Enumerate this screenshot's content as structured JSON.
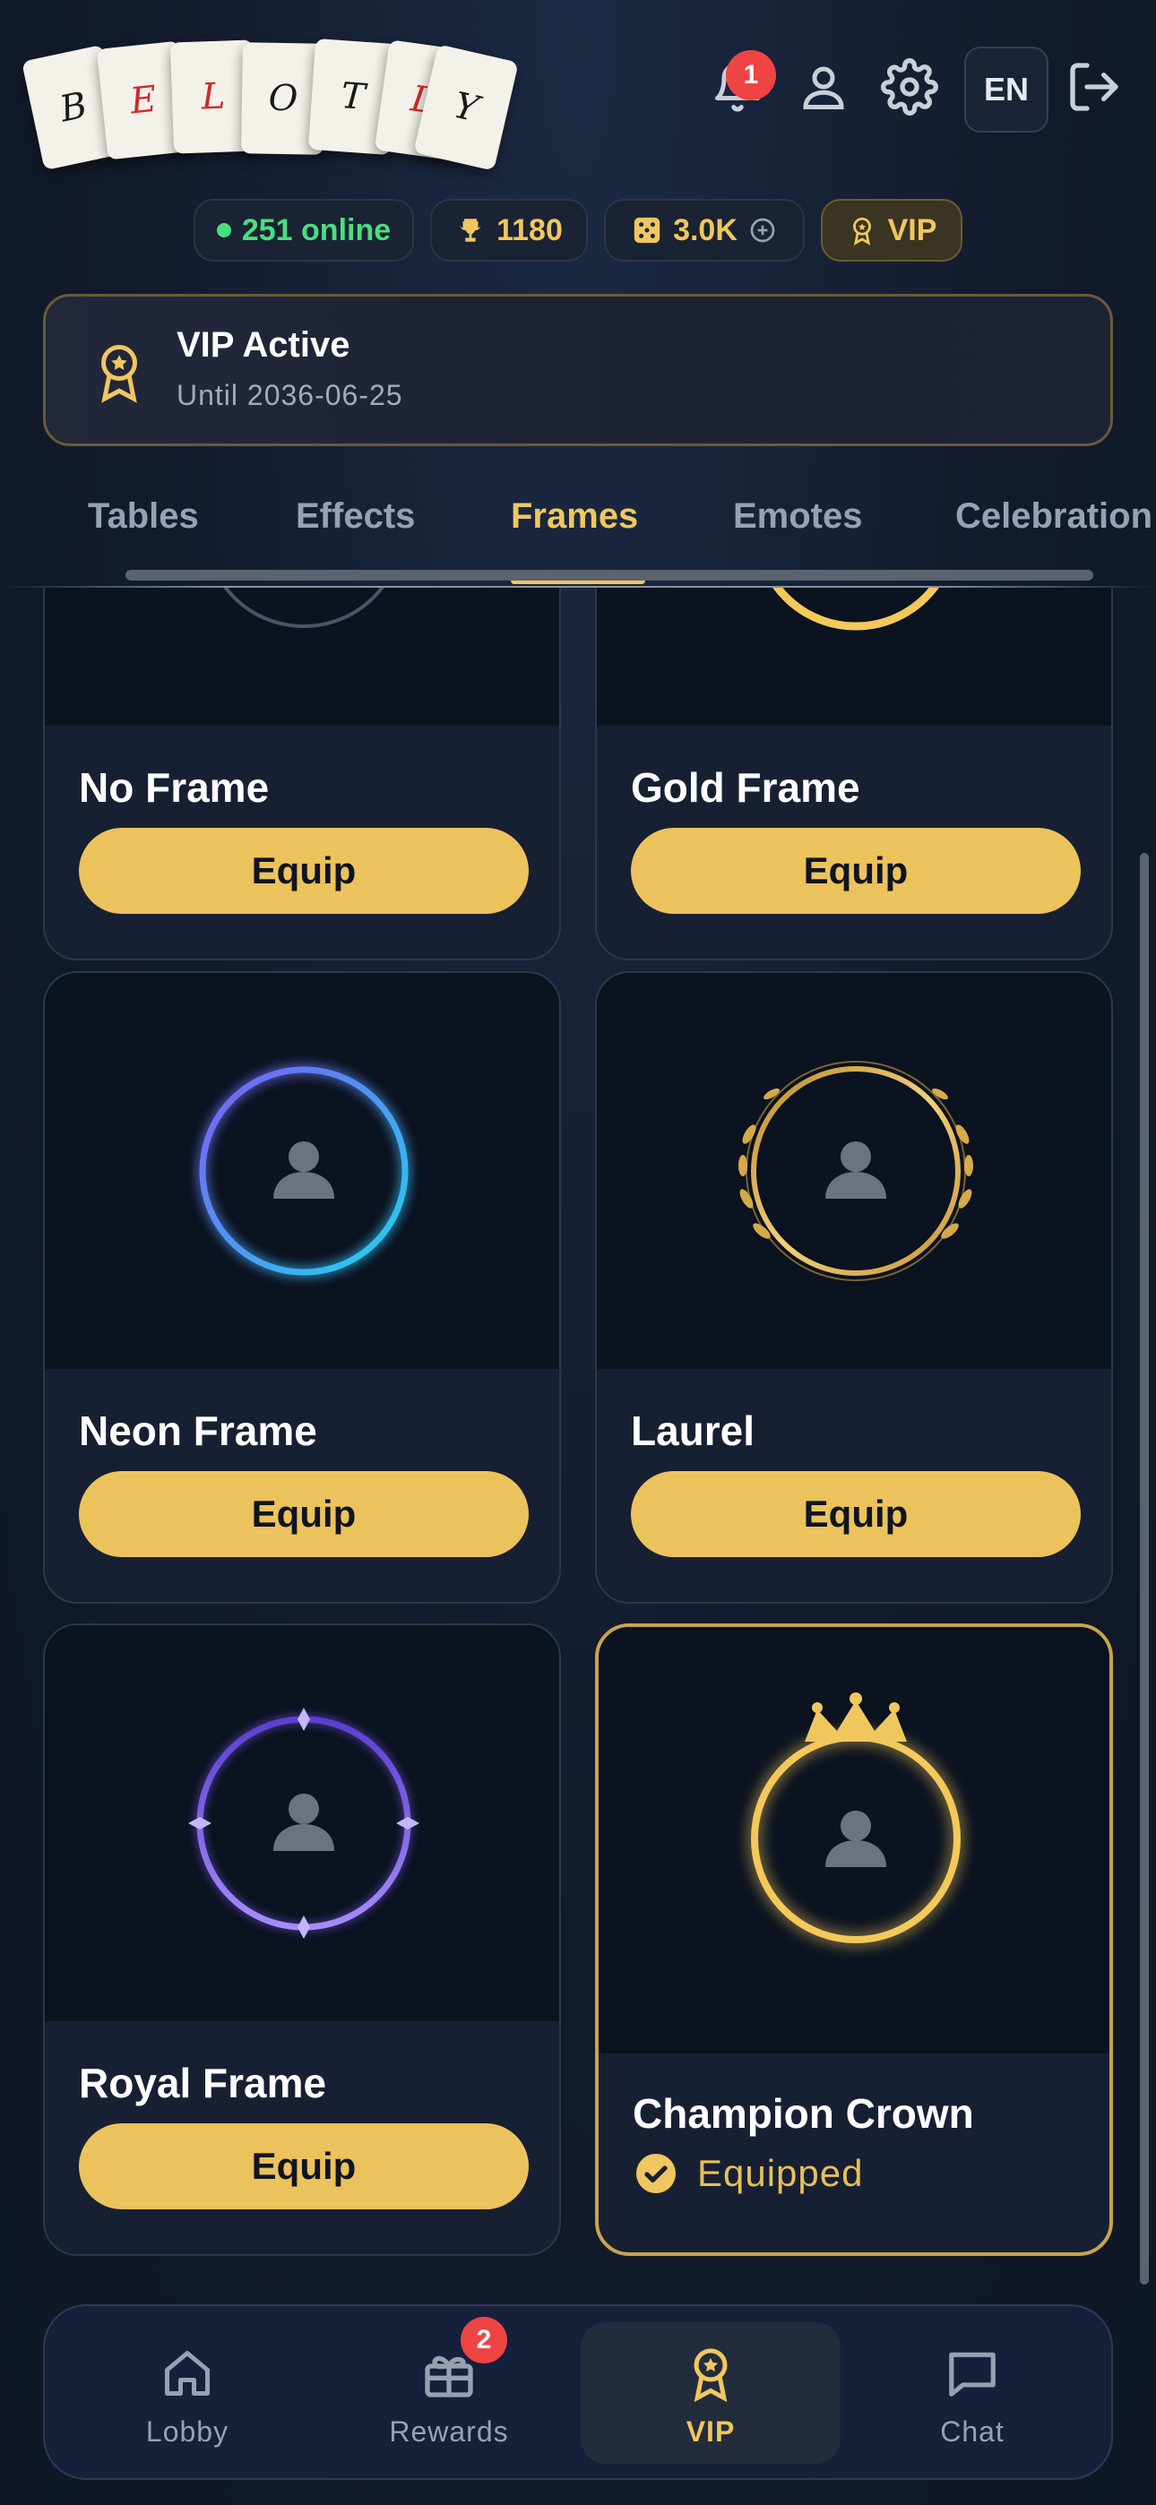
{
  "app": {
    "logo_letters": [
      "B",
      "E",
      "L",
      "O",
      "T",
      "L",
      "Y"
    ],
    "brand_colors": {
      "gold": "#ecc25c",
      "background": "#131c2c",
      "red": "#cf2a2a"
    }
  },
  "header": {
    "notification_count": "1",
    "language": "EN",
    "icons": [
      "bell-icon",
      "user-icon",
      "gear-icon",
      "logout-icon"
    ]
  },
  "stats": {
    "online": "251 online",
    "trophies": "1180",
    "chips": "3.0K",
    "vip": "VIP"
  },
  "vip_banner": {
    "title": "VIP Active",
    "subtitle": "Until 2036-06-25"
  },
  "tabs": [
    {
      "label": "Tables",
      "active": false
    },
    {
      "label": "Effects",
      "active": false
    },
    {
      "label": "Frames",
      "active": true
    },
    {
      "label": "Emotes",
      "active": false
    },
    {
      "label": "Celebration",
      "active": false
    }
  ],
  "frames": [
    {
      "name": "No Frame",
      "action": "Equip",
      "equipped": false
    },
    {
      "name": "Gold Frame",
      "action": "Equip",
      "equipped": false
    },
    {
      "name": "Neon Frame",
      "action": "Equip",
      "equipped": false
    },
    {
      "name": "Laurel",
      "action": "Equip",
      "equipped": false
    },
    {
      "name": "Royal Frame",
      "action": "Equip",
      "equipped": false
    },
    {
      "name": "Champion Crown",
      "action": "Equipped",
      "equipped": true
    }
  ],
  "bottom_nav": [
    {
      "label": "Lobby",
      "icon": "home-icon",
      "active": false
    },
    {
      "label": "Rewards",
      "icon": "gift-icon",
      "active": false,
      "badge": "2"
    },
    {
      "label": "VIP",
      "icon": "vip-badge-icon",
      "active": true
    },
    {
      "label": "Chat",
      "icon": "chat-icon",
      "active": false
    }
  ]
}
